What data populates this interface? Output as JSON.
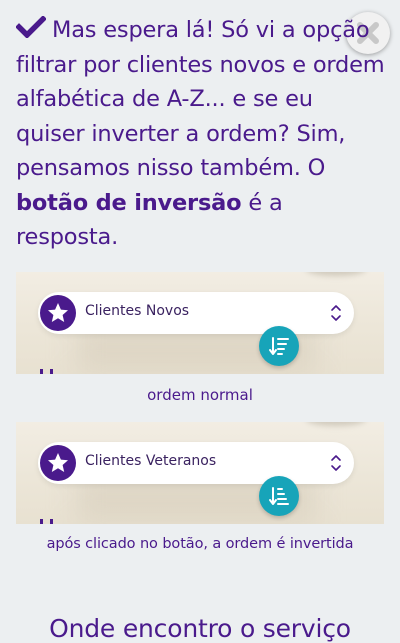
{
  "close_button": {
    "icon": "close-icon"
  },
  "intro": {
    "check_icon": "checkmark-icon",
    "text_before": "Mas espera lá! Só vi a opção filtrar por clientes novos e ordem alfabética de A-Z... e se eu quiser inverter a ordem? Sim, pensamos nisso também. O ",
    "bold_text": "botão de inversão",
    "text_after": " é a resposta."
  },
  "example_normal": {
    "filter_label": "Clientes Novos",
    "badge_icon": "star-icon",
    "select_icon": "chevron-updown-icon",
    "sort_icon": "sort-descending-icon",
    "caption": "ordem normal"
  },
  "example_inverted": {
    "filter_label": "Clientes Veteranos",
    "badge_icon": "star-icon",
    "select_icon": "chevron-updown-icon",
    "sort_icon": "sort-ascending-icon",
    "caption": "após clicado no botão, a ordem é invertida"
  },
  "next_section": {
    "heading": "Onde encontro o serviço"
  },
  "colors": {
    "brand_purple": "#4a1a8c",
    "teal": "#17a4b9",
    "background": "#eceff1"
  }
}
